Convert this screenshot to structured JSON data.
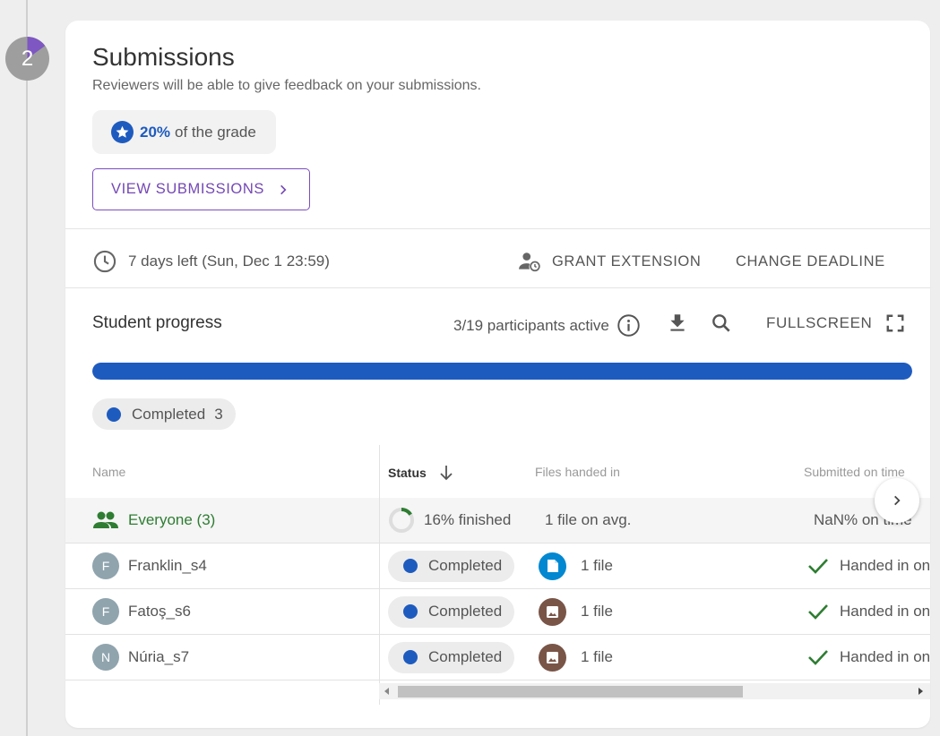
{
  "step": {
    "number": "2",
    "progress_fraction": 0.16
  },
  "card": {
    "title": "Submissions",
    "subtitle": "Reviewers will be able to give feedback on your submissions.",
    "grade_percent": "20%",
    "grade_suffix": "of the grade",
    "view_submissions_label": "VIEW SUBMISSIONS"
  },
  "deadline": {
    "text": "7 days left (Sun, Dec 1 23:59)",
    "grant_extension_label": "GRANT EXTENSION",
    "change_deadline_label": "CHANGE DEADLINE"
  },
  "progress": {
    "title": "Student progress",
    "participants_text": "3/19 participants active",
    "fullscreen_label": "FULLSCREEN",
    "completed_fraction": 1.0,
    "legend": {
      "label": "Completed",
      "count": "3"
    }
  },
  "table": {
    "headers": {
      "name": "Name",
      "status": "Status",
      "files": "Files handed in",
      "submitted": "Submitted on time"
    },
    "everyone": {
      "name": "Everyone (3)",
      "status": "16% finished",
      "files": "1 file on avg.",
      "submitted": "NaN% on time"
    },
    "rows": [
      {
        "initial": "F",
        "name": "Franklin_s4",
        "status": "Completed",
        "files": "1 file",
        "file_type": "document-icon",
        "submitted": "Handed in on"
      },
      {
        "initial": "F",
        "name": "Fatoş_s6",
        "status": "Completed",
        "files": "1 file",
        "file_type": "image-icon",
        "submitted": "Handed in on"
      },
      {
        "initial": "N",
        "name": "Núria_s7",
        "status": "Completed",
        "files": "1 file",
        "file_type": "image-icon",
        "submitted": "Handed in on"
      }
    ]
  },
  "colors": {
    "accent_blue": "#1e5bbf",
    "purple": "#7448b5",
    "green": "#2e7d32",
    "doc_icon": "#0288d1",
    "image_icon": "#795548"
  }
}
